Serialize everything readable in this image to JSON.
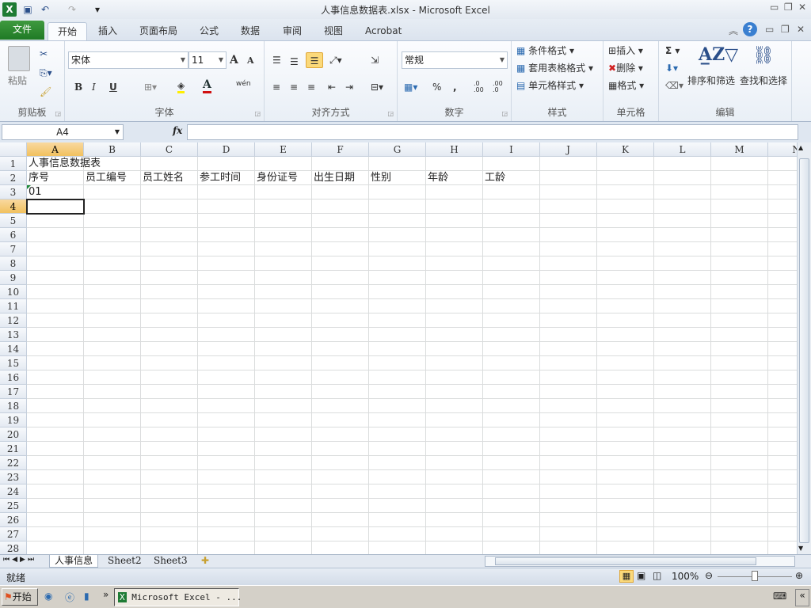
{
  "window": {
    "title": "人事信息数据表.xlsx  -  Microsoft Excel"
  },
  "ribbon_tabs": [
    "文件",
    "开始",
    "插入",
    "页面布局",
    "公式",
    "数据",
    "审阅",
    "视图",
    "Acrobat"
  ],
  "active_tab": "开始",
  "clipboard": {
    "paste": "粘贴",
    "label": "剪贴板"
  },
  "font": {
    "name": "宋体",
    "size": "11",
    "label": "字体",
    "bold": "B",
    "italic": "I",
    "underline": "U",
    "grow": "A",
    "shrink": "A",
    "font_color": "A",
    "phonetic": "wén"
  },
  "alignment": {
    "label": "对齐方式"
  },
  "number": {
    "format": "常规",
    "label": "数字",
    "percent": "%",
    "comma": ",",
    "inc_decimal": ".0 .00",
    "dec_decimal": ".00 .0"
  },
  "styles": {
    "items": [
      "条件格式",
      "套用表格格式",
      "单元格样式"
    ],
    "label": "样式"
  },
  "cells": {
    "items": [
      "插入",
      "删除",
      "格式"
    ],
    "label": "单元格"
  },
  "editing": {
    "sum": "Σ",
    "sort": "排序和筛选",
    "find": "查找和选择",
    "label": "编辑"
  },
  "formula_bar": {
    "name_box": "A4",
    "fx": "fx",
    "value": ""
  },
  "grid": {
    "columns": [
      "A",
      "B",
      "C",
      "D",
      "E",
      "F",
      "G",
      "H",
      "I",
      "J",
      "K",
      "L",
      "M",
      "N"
    ],
    "row_count": 28,
    "selected": "A4",
    "cells": [
      {
        "ref": "A1",
        "row": 1,
        "col": 0,
        "value": "人事信息数据表"
      },
      {
        "ref": "A2",
        "row": 2,
        "col": 0,
        "value": "序号"
      },
      {
        "ref": "B2",
        "row": 2,
        "col": 1,
        "value": "员工编号"
      },
      {
        "ref": "C2",
        "row": 2,
        "col": 2,
        "value": "员工姓名"
      },
      {
        "ref": "D2",
        "row": 2,
        "col": 3,
        "value": "参工时间"
      },
      {
        "ref": "E2",
        "row": 2,
        "col": 4,
        "value": "身份证号"
      },
      {
        "ref": "F2",
        "row": 2,
        "col": 5,
        "value": "出生日期"
      },
      {
        "ref": "G2",
        "row": 2,
        "col": 6,
        "value": "性别"
      },
      {
        "ref": "H2",
        "row": 2,
        "col": 7,
        "value": "年龄"
      },
      {
        "ref": "I2",
        "row": 2,
        "col": 8,
        "value": "工龄"
      },
      {
        "ref": "A3",
        "row": 3,
        "col": 0,
        "value": "01"
      }
    ]
  },
  "sheets": [
    "人事信息",
    "Sheet2",
    "Sheet3"
  ],
  "active_sheet": "人事信息",
  "status": {
    "ready": "就绪",
    "zoom": "100%",
    "zoom_fraction": 0.5
  },
  "taskbar": {
    "start": "开始",
    "task": "Microsoft Excel - ..."
  },
  "colors": {
    "file_tab": "#2a8a2f",
    "selection_header": "#f1c15f",
    "accent": "#1f7a25"
  }
}
